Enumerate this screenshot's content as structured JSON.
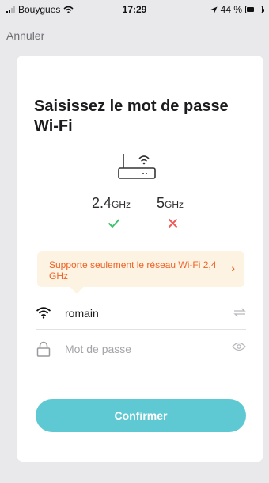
{
  "status_bar": {
    "carrier": "Bouygues",
    "time": "17:29",
    "battery": "44 %",
    "battery_level": 0.44
  },
  "nav": {
    "cancel_label": "Annuler"
  },
  "card": {
    "title": "Saisissez le mot de passe Wi-Fi",
    "bands": [
      {
        "value": "2.4",
        "unit": "GHz",
        "supported": true,
        "status_icon": "check-icon"
      },
      {
        "value": "5",
        "unit": "GHz",
        "supported": false,
        "status_icon": "cross-icon"
      }
    ],
    "notice": "Supporte seulement le réseau Wi-Fi 2,4 GHz",
    "ssid_value": "romain",
    "password_placeholder": "Mot de passe",
    "confirm_label": "Confirmer"
  },
  "colors": {
    "accent": "#5ec9d3",
    "ok": "#3cc26a",
    "error": "#ef5a56",
    "notice_text": "#f06226",
    "notice_bg": "#fdf3e2"
  }
}
